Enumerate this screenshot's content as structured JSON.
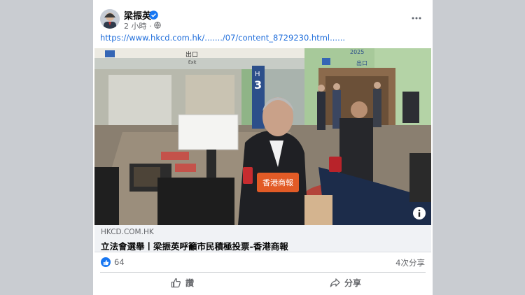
{
  "post": {
    "author": "梁振英",
    "time": "2 小時 ·",
    "privacy_icon": "globe-icon",
    "text": "https://www.hkcd.com.hk/......./07/content_8729230.html......"
  },
  "link": {
    "domain": "HKCD.COM.HK",
    "title": "立法會選舉丨梁振英呼籲市民積極投票-香港商報"
  },
  "photo": {
    "signs": {
      "exit_top": "出口",
      "exit_sub": "Exit",
      "year_banner": "2025",
      "exit_right": "出口",
      "pillar_letter": "H",
      "pillar_number": "3"
    },
    "mic_logo": "香港商報"
  },
  "stats": {
    "likes": "64",
    "shares": "4次分享"
  },
  "actions": {
    "like": "讚",
    "share": "分享"
  },
  "colors": {
    "link": "#216fdb",
    "like_blue": "#1877f2",
    "page_bg": "#c9ccd1"
  }
}
